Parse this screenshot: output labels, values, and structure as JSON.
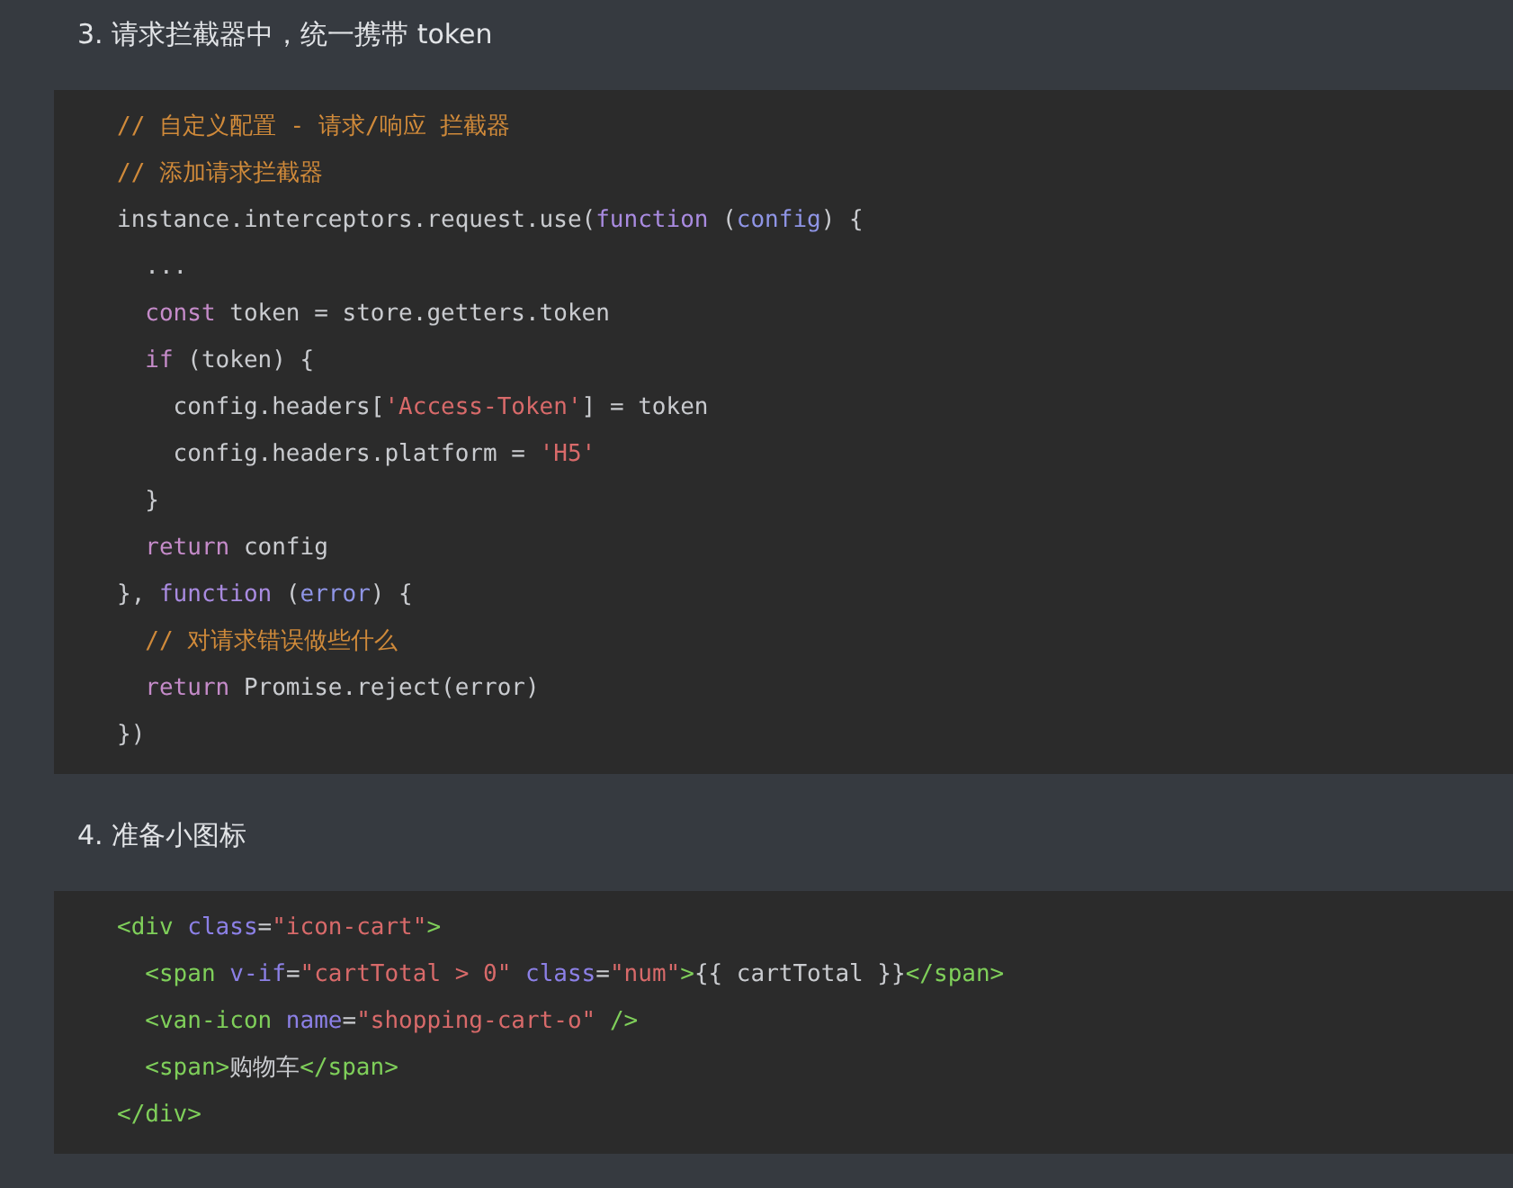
{
  "sections": [
    {
      "heading": "3. 请求拦截器中，统一携带 token",
      "code": [
        [
          {
            "kind": "comment",
            "text": "// 自定义配置 - 请求/响应 拦截器"
          }
        ],
        [
          {
            "kind": "comment",
            "text": "// 添加请求拦截器"
          }
        ],
        [
          {
            "kind": "plain",
            "text": "instance.interceptors.request.use("
          },
          {
            "kind": "function",
            "text": "function"
          },
          {
            "kind": "plain",
            "text": " ("
          },
          {
            "kind": "param",
            "text": "config"
          },
          {
            "kind": "plain",
            "text": ") {"
          }
        ],
        [
          {
            "kind": "plain",
            "text": "  ..."
          }
        ],
        [
          {
            "kind": "keyword",
            "text": "  const"
          },
          {
            "kind": "plain",
            "text": " token = store.getters.token"
          }
        ],
        [
          {
            "kind": "keyword",
            "text": "  if"
          },
          {
            "kind": "plain",
            "text": " (token) {"
          }
        ],
        [
          {
            "kind": "plain",
            "text": "    config.headers["
          },
          {
            "kind": "string",
            "text": "'Access-Token'"
          },
          {
            "kind": "plain",
            "text": "] = token"
          }
        ],
        [
          {
            "kind": "plain",
            "text": "    config.headers.platform = "
          },
          {
            "kind": "string",
            "text": "'H5'"
          }
        ],
        [
          {
            "kind": "plain",
            "text": "  }"
          }
        ],
        [
          {
            "kind": "keyword",
            "text": "  return"
          },
          {
            "kind": "plain",
            "text": " config"
          }
        ],
        [
          {
            "kind": "plain",
            "text": "}, "
          },
          {
            "kind": "function",
            "text": "function"
          },
          {
            "kind": "plain",
            "text": " ("
          },
          {
            "kind": "param",
            "text": "error"
          },
          {
            "kind": "plain",
            "text": ") {"
          }
        ],
        [
          {
            "kind": "comment",
            "text": "  // 对请求错误做些什么"
          }
        ],
        [
          {
            "kind": "keyword",
            "text": "  return"
          },
          {
            "kind": "plain",
            "text": " Promise.reject(error)"
          }
        ],
        [
          {
            "kind": "plain",
            "text": "})"
          }
        ]
      ]
    },
    {
      "heading": "4. 准备小图标",
      "code": [
        [
          {
            "kind": "tag",
            "text": "<div"
          },
          {
            "kind": "attr",
            "text": " class"
          },
          {
            "kind": "plain",
            "text": "="
          },
          {
            "kind": "string",
            "text": "\"icon-cart\""
          },
          {
            "kind": "tag",
            "text": ">"
          }
        ],
        [
          {
            "kind": "tag",
            "text": "  <span"
          },
          {
            "kind": "attr",
            "text": " v-if"
          },
          {
            "kind": "plain",
            "text": "="
          },
          {
            "kind": "string",
            "text": "\"cartTotal > 0\""
          },
          {
            "kind": "attr",
            "text": " class"
          },
          {
            "kind": "plain",
            "text": "="
          },
          {
            "kind": "string",
            "text": "\"num\""
          },
          {
            "kind": "tag",
            "text": ">"
          },
          {
            "kind": "plain",
            "text": "{{ cartTotal }}"
          },
          {
            "kind": "tag",
            "text": "</span>"
          }
        ],
        [
          {
            "kind": "tag",
            "text": "  <van-icon"
          },
          {
            "kind": "attr",
            "text": " name"
          },
          {
            "kind": "plain",
            "text": "="
          },
          {
            "kind": "string",
            "text": "\"shopping-cart-o\""
          },
          {
            "kind": "tag",
            "text": " />"
          }
        ],
        [
          {
            "kind": "tag",
            "text": "  <span>"
          },
          {
            "kind": "plain",
            "text": "购物车"
          },
          {
            "kind": "tag",
            "text": "</span>"
          }
        ],
        [
          {
            "kind": "tag",
            "text": "</div>"
          }
        ]
      ]
    }
  ]
}
